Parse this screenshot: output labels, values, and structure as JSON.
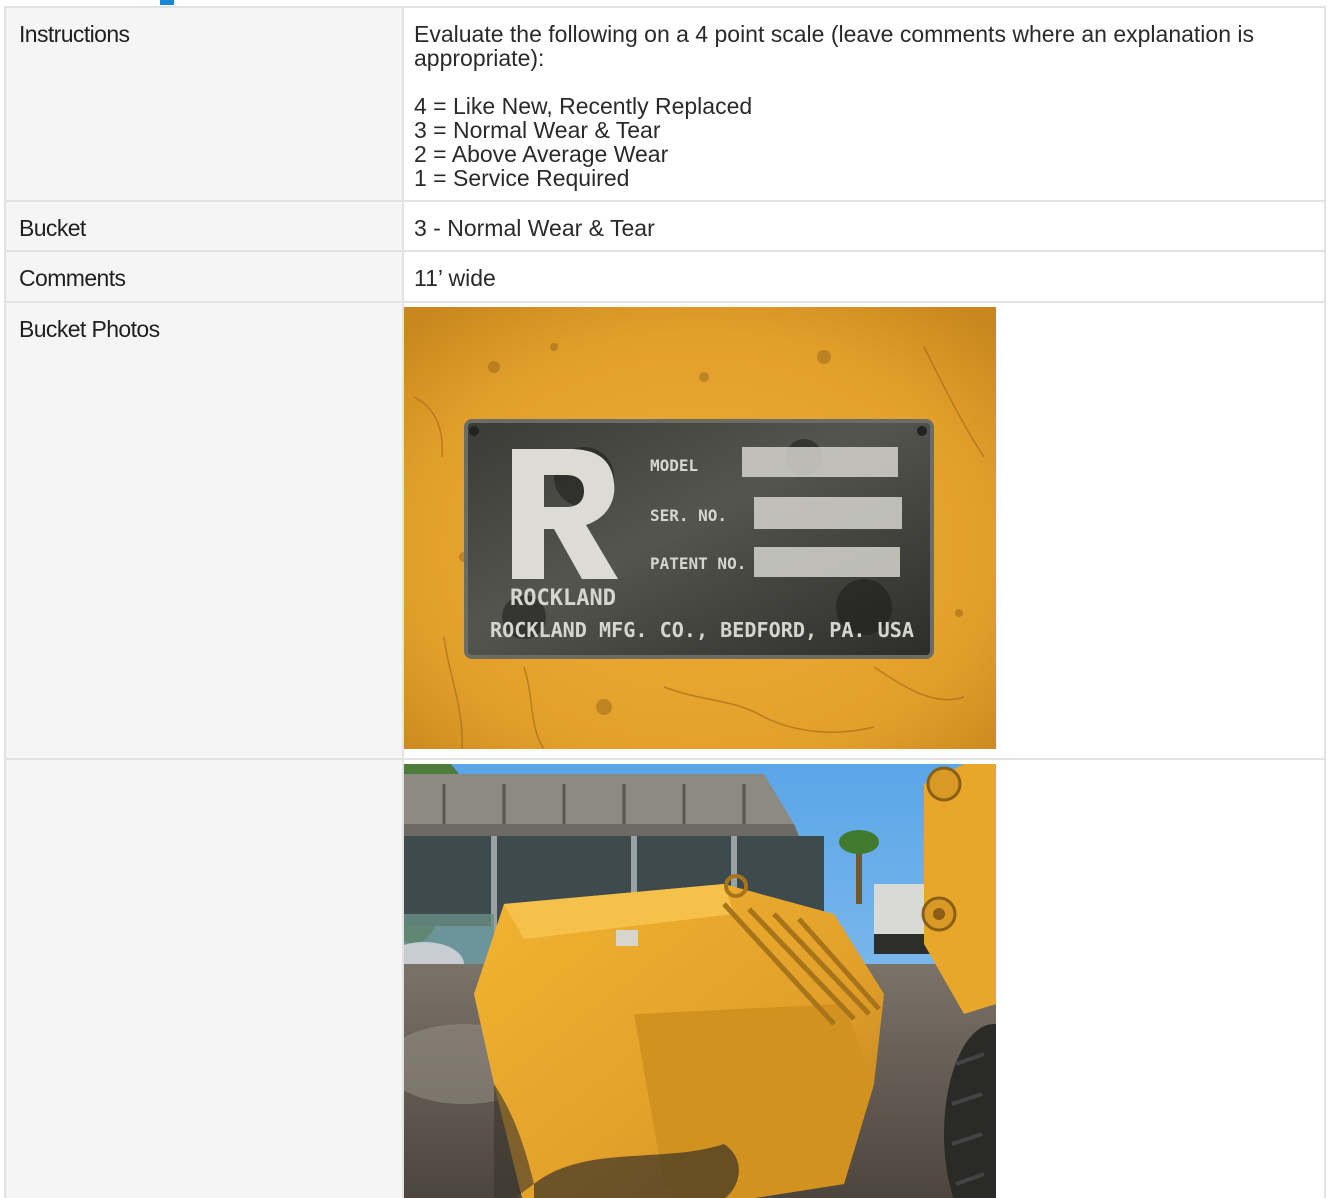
{
  "rows": {
    "instructions": {
      "label": "Instructions",
      "intro": "Evaluate the following on a 4 point scale (leave comments where an explanation is appropriate):",
      "scale": [
        "4 = Like New, Recently Replaced",
        "3 = Normal Wear & Tear",
        "2 = Above Average Wear",
        "1 = Service Required"
      ]
    },
    "bucket": {
      "label": "Bucket",
      "value": "3 - Normal Wear & Tear"
    },
    "comments": {
      "label": "Comments",
      "value": "11’ wide"
    },
    "bucket_photos": {
      "label": "Bucket Photos",
      "photo1": {
        "icon": "nameplate-photo",
        "plate_labels": [
          "MODEL",
          "SER. NO.",
          "PATENT NO."
        ],
        "brand": "ROCKLAND",
        "maker_line": "ROCKLAND MFG. CO., BEDFORD, PA. USA"
      },
      "photo2": {
        "icon": "loader-bucket-photo"
      }
    }
  },
  "colors": {
    "accent": "#1a88d8",
    "label_bg": "#f5f5f5",
    "border": "#e2e2e2",
    "bucket_yellow": "#e8a429"
  }
}
